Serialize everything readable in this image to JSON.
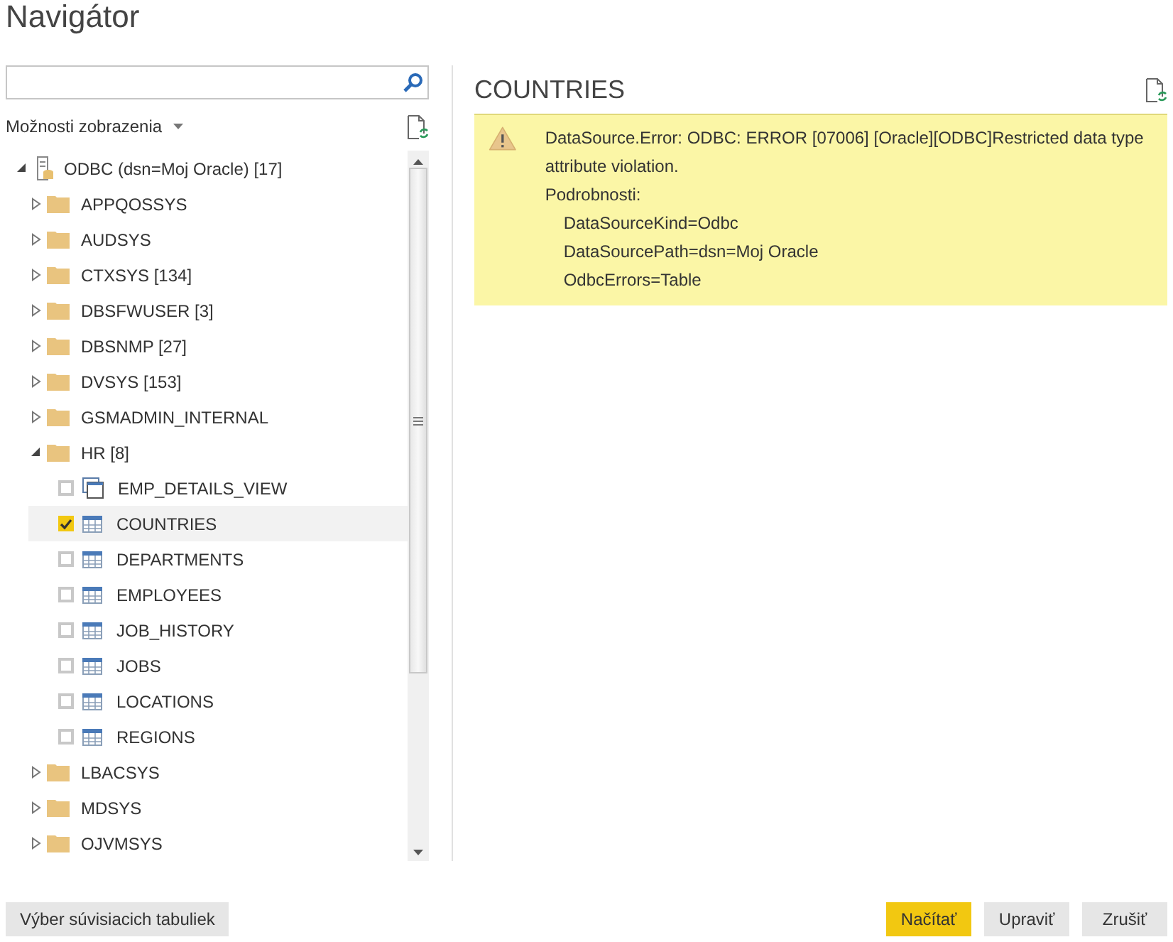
{
  "window": {
    "title": "Navigátor"
  },
  "view_options": {
    "label": "Možnosti zobrazenia"
  },
  "tree": {
    "label": "ODBC (dsn=Moj Oracle) [17]",
    "kind": "database",
    "expanded": true,
    "children": [
      {
        "label": "APPQOSSYS",
        "kind": "folder",
        "expanded": false
      },
      {
        "label": "AUDSYS",
        "kind": "folder",
        "expanded": false
      },
      {
        "label": "CTXSYS [134]",
        "kind": "folder",
        "expanded": false
      },
      {
        "label": "DBSFWUSER [3]",
        "kind": "folder",
        "expanded": false
      },
      {
        "label": "DBSNMP [27]",
        "kind": "folder",
        "expanded": false
      },
      {
        "label": "DVSYS [153]",
        "kind": "folder",
        "expanded": false
      },
      {
        "label": "GSMADMIN_INTERNAL",
        "kind": "folder",
        "expanded": false
      },
      {
        "label": "HR [8]",
        "kind": "folder",
        "expanded": true,
        "children": [
          {
            "label": "EMP_DETAILS_VIEW",
            "kind": "view",
            "checked": false,
            "selected": false
          },
          {
            "label": "COUNTRIES",
            "kind": "table",
            "checked": true,
            "selected": true
          },
          {
            "label": "DEPARTMENTS",
            "kind": "table",
            "checked": false,
            "selected": false
          },
          {
            "label": "EMPLOYEES",
            "kind": "table",
            "checked": false,
            "selected": false
          },
          {
            "label": "JOB_HISTORY",
            "kind": "table",
            "checked": false,
            "selected": false
          },
          {
            "label": "JOBS",
            "kind": "table",
            "checked": false,
            "selected": false
          },
          {
            "label": "LOCATIONS",
            "kind": "table",
            "checked": false,
            "selected": false
          },
          {
            "label": "REGIONS",
            "kind": "table",
            "checked": false,
            "selected": false
          }
        ]
      },
      {
        "label": "LBACSYS",
        "kind": "folder",
        "expanded": false
      },
      {
        "label": "MDSYS",
        "kind": "folder",
        "expanded": false
      },
      {
        "label": "OJVMSYS",
        "kind": "folder",
        "expanded": false
      }
    ]
  },
  "preview": {
    "title": "COUNTRIES",
    "error": {
      "message": "DataSource.Error: ODBC: ERROR [07006] [Oracle][ODBC]Restricted data type attribute violation.",
      "details_label": "Podrobnosti:",
      "details": [
        "DataSourceKind=Odbc",
        "DataSourcePath=dsn=Moj Oracle",
        "OdbcErrors=Table"
      ]
    }
  },
  "footer": {
    "left_button": "Výber súvisiacich tabuliek",
    "buttons": [
      {
        "label": "Načítať",
        "primary": true
      },
      {
        "label": "Upraviť",
        "primary": false
      },
      {
        "label": "Zrušiť",
        "primary": false
      }
    ]
  }
}
